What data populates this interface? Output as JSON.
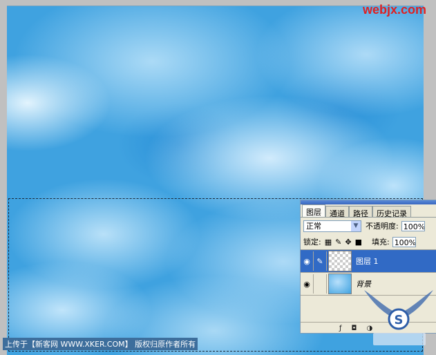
{
  "watermark_top": "webjx.com",
  "caption": "上传于【新客网 WWW.XKER.COM】 版权归原作者所有",
  "layers_panel": {
    "tabs": [
      "图层",
      "通道",
      "路径",
      "历史记录"
    ],
    "blend_mode": "正常",
    "opacity_label": "不透明度:",
    "opacity_value": "100%",
    "lock_label": "锁定:",
    "fill_label": "填充:",
    "fill_value": "100%",
    "layers": [
      {
        "name": "图层 1",
        "selected": true
      },
      {
        "name": "背景",
        "selected": false
      }
    ]
  },
  "colors": {
    "sky": "#3fa2e0",
    "panel_bg": "#ece9d8",
    "selected_layer": "#316ac5",
    "watermark": "#e02020",
    "caption_bg": "#3d6e9c"
  }
}
